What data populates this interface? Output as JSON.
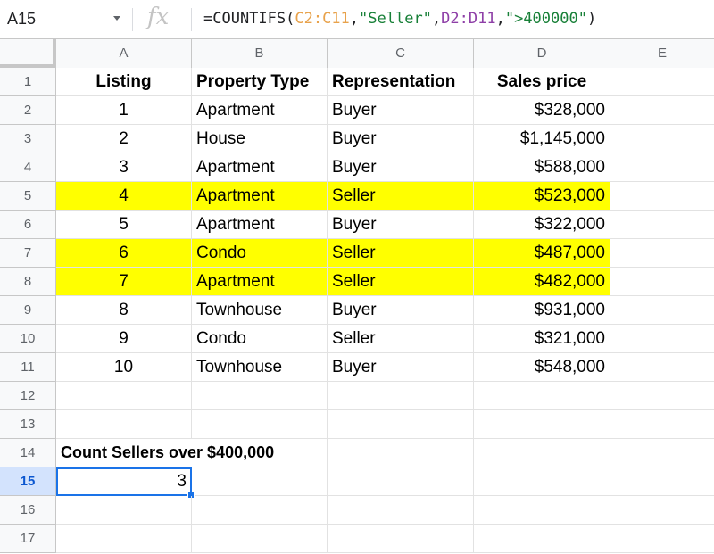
{
  "formula_bar": {
    "cell_ref": "A15",
    "fx_label": "fx",
    "formula_parts": [
      "=COUNTIFS(",
      "C2:C11",
      ",",
      "\"Seller\"",
      ",",
      "D2:D11",
      ",",
      "\">400000\"",
      ")"
    ]
  },
  "columns": [
    "A",
    "B",
    "C",
    "D",
    "E"
  ],
  "headers": {
    "listing": "Listing",
    "property_type": "Property Type",
    "representation": "Representation",
    "sales_price": "Sales price"
  },
  "rows": [
    {
      "row": "2",
      "listing": "1",
      "type": "Apartment",
      "rep": "Buyer",
      "price": "$328,000",
      "highlight": false
    },
    {
      "row": "3",
      "listing": "2",
      "type": "House",
      "rep": "Buyer",
      "price": "$1,145,000",
      "highlight": false
    },
    {
      "row": "4",
      "listing": "3",
      "type": "Apartment",
      "rep": "Buyer",
      "price": "$588,000",
      "highlight": false
    },
    {
      "row": "5",
      "listing": "4",
      "type": "Apartment",
      "rep": "Seller",
      "price": "$523,000",
      "highlight": true
    },
    {
      "row": "6",
      "listing": "5",
      "type": "Apartment",
      "rep": "Buyer",
      "price": "$322,000",
      "highlight": false
    },
    {
      "row": "7",
      "listing": "6",
      "type": "Condo",
      "rep": "Seller",
      "price": "$487,000",
      "highlight": true
    },
    {
      "row": "8",
      "listing": "7",
      "type": "Apartment",
      "rep": "Seller",
      "price": "$482,000",
      "highlight": true
    },
    {
      "row": "9",
      "listing": "8",
      "type": "Townhouse",
      "rep": "Buyer",
      "price": "$931,000",
      "highlight": false
    },
    {
      "row": "10",
      "listing": "9",
      "type": "Condo",
      "rep": "Seller",
      "price": "$321,000",
      "highlight": false
    },
    {
      "row": "11",
      "listing": "10",
      "type": "Townhouse",
      "rep": "Buyer",
      "price": "$548,000",
      "highlight": false
    }
  ],
  "row_numbers": [
    "1",
    "2",
    "3",
    "4",
    "5",
    "6",
    "7",
    "8",
    "9",
    "10",
    "11",
    "12",
    "13",
    "14",
    "15",
    "16",
    "17"
  ],
  "summary_label": "Count Sellers over $400,000",
  "result_value": "3",
  "colors": {
    "highlight": "#ffff00",
    "selection": "#1a73e8",
    "range_c": "#e8a24b",
    "range_d": "#8e3fa7",
    "string": "#188038"
  }
}
